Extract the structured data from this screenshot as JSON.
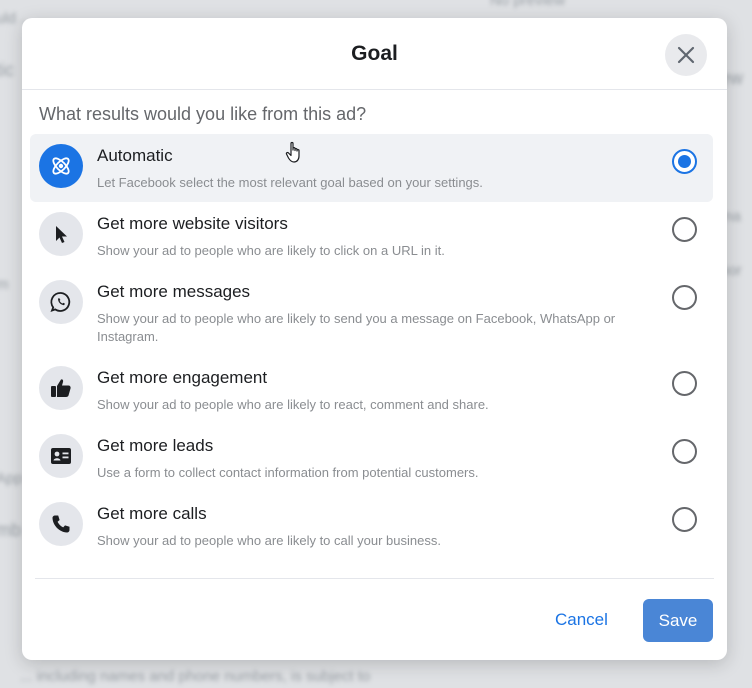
{
  "modal": {
    "title": "Goal",
    "question": "What results would you like from this ad?",
    "cancel_label": "Cancel",
    "save_label": "Save"
  },
  "options": [
    {
      "title": "Automatic",
      "desc": "Let Facebook select the most relevant goal based on your settings.",
      "icon": "atom-icon",
      "selected": true
    },
    {
      "title": "Get more website visitors",
      "desc": "Show your ad to people who are likely to click on a URL in it.",
      "icon": "cursor-icon",
      "selected": false
    },
    {
      "title": "Get more messages",
      "desc": "Show your ad to people who are likely to send you a message on Facebook, WhatsApp or Instagram.",
      "icon": "whatsapp-icon",
      "selected": false
    },
    {
      "title": "Get more engagement",
      "desc": "Show your ad to people who are likely to react, comment and share.",
      "icon": "thumbs-up-icon",
      "selected": false
    },
    {
      "title": "Get more leads",
      "desc": "Use a form to collect contact information from potential customers.",
      "icon": "contact-card-icon",
      "selected": false
    },
    {
      "title": "Get more calls",
      "desc": "Show your ad to people who are likely to call your business.",
      "icon": "phone-icon",
      "selected": false
    }
  ],
  "colors": {
    "accent": "#1b74e4",
    "save_button": "#4a86d6",
    "selected_row": "#f0f2f5"
  }
}
